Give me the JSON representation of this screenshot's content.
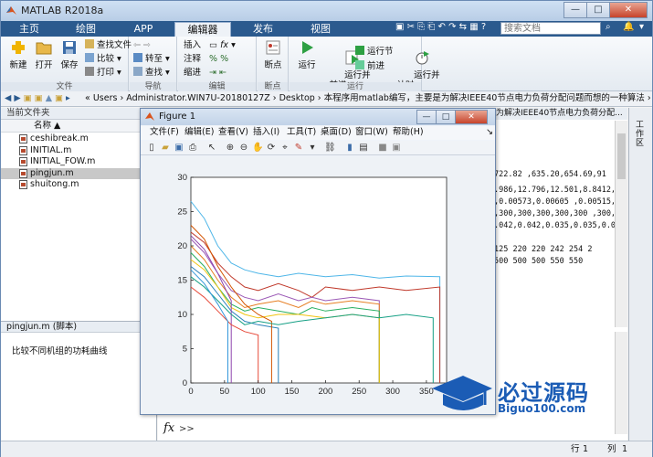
{
  "window": {
    "title": "MATLAB R2018a"
  },
  "tabs": [
    {
      "label": "主页"
    },
    {
      "label": "绘图"
    },
    {
      "label": "APP"
    },
    {
      "label": "编辑器"
    },
    {
      "label": "发布"
    },
    {
      "label": "视图"
    }
  ],
  "search": {
    "placeholder": "搜索文档"
  },
  "ribbon": {
    "file_group": {
      "label": "文件",
      "new": "新建",
      "open": "打开",
      "save": "保存",
      "find_files": "查找文件",
      "compare": "比较",
      "print": "打印"
    },
    "nav_group": {
      "label": "导航",
      "goto": "转至",
      "find": "查找"
    },
    "edit_group": {
      "label": "编辑",
      "insert": "插入",
      "comment": "注释",
      "indent": "缩进"
    },
    "breakpoint_group": {
      "label": "断点",
      "breakpoints": "断点"
    },
    "run_group": {
      "label": "运行",
      "run": "运行",
      "run_advance": "运行并\n前进",
      "run_section": "运行节",
      "advance": "前进",
      "run_time": "运行并\n计时"
    }
  },
  "address": {
    "path": "« Users › Administrator.WIN7U-20180127Z › Desktop › 本程序用matlab编写，主要是为解决IEEE40节点电力负荷分配问题而想的一种算法 › 水桶法"
  },
  "current_folder": {
    "title": "当前文件夹",
    "column": "名称",
    "files": [
      "ceshibreak.m",
      "INITIAL.m",
      "INITIAL_FOW.m",
      "pingjun.m",
      "shuitong.m"
    ],
    "selected_index": 3,
    "detail_title": "pingjun.m  (脚本)",
    "detail_text": "比较不同机组的功耗曲线"
  },
  "command_window": {
    "tab": "为解决IEEE40节点电力负荷分配...",
    "lines": [
      "722.82   ,635.20,654.69,91",
      ".986,12.796,12.501,8.8412,9.",
      ",0.00573,0.00605  ,0.00515,",
      ",300,300,300,300,300  ,300,",
      ".042,0.042,0.035,0.035,0.03",
      "",
      "125  220  220  242   254  2",
      "    500  500  500  550   550"
    ],
    "prompt": "fx",
    "prompt_arrows": ">>"
  },
  "right_panel": {
    "label": "工作区"
  },
  "statusbar": {
    "row_label": "行",
    "row": "1",
    "col_label": "列",
    "col": "1"
  },
  "figure": {
    "title": "Figure 1",
    "menus": [
      "文件(F)",
      "编辑(E)",
      "查看(V)",
      "插入(I)",
      "工具(T)",
      "桌面(D)",
      "窗口(W)",
      "帮助(H)"
    ]
  },
  "chart_data": {
    "type": "line",
    "xlim": [
      0,
      380
    ],
    "ylim": [
      0,
      30
    ],
    "xticks": [
      0,
      50,
      100,
      150,
      200,
      250,
      300,
      350
    ],
    "yticks": [
      0,
      5,
      10,
      15,
      20,
      25,
      30
    ],
    "grid": false,
    "series": [
      {
        "color": "#4fb6e8",
        "x": [
          0,
          20,
          40,
          60,
          80,
          100,
          130,
          160,
          200,
          240,
          280,
          320,
          370
        ],
        "y": [
          26.5,
          24,
          20,
          17.5,
          16.5,
          16,
          15.5,
          16,
          15.5,
          15.8,
          15.3,
          15.6,
          15.5
        ]
      },
      {
        "color": "#c0392b",
        "x": [
          0,
          20,
          40,
          60,
          80,
          100,
          130,
          160,
          180,
          200,
          240,
          280,
          320,
          370
        ],
        "y": [
          22,
          20.5,
          17.5,
          15.5,
          14,
          13.5,
          14.5,
          13.5,
          12.5,
          14,
          13.5,
          14,
          13.5,
          14
        ]
      },
      {
        "color": "#9b59b6",
        "x": [
          0,
          20,
          40,
          60,
          80,
          100,
          130,
          160,
          180,
          200,
          240,
          280
        ],
        "y": [
          21,
          19,
          16,
          13.5,
          12.5,
          12,
          13,
          12,
          12.5,
          12,
          12.5,
          12
        ]
      },
      {
        "color": "#e67e22",
        "x": [
          0,
          20,
          40,
          60,
          80,
          100,
          130,
          160,
          180,
          200,
          240,
          280
        ],
        "y": [
          20,
          18,
          15,
          12.5,
          11,
          11.5,
          12,
          11,
          12,
          11.5,
          12,
          11.5
        ]
      },
      {
        "color": "#27ae60",
        "x": [
          0,
          20,
          40,
          60,
          80,
          100,
          130,
          160,
          180,
          200,
          240,
          280
        ],
        "y": [
          19,
          17,
          14,
          11.5,
          10.5,
          11,
          10.5,
          10,
          11,
          10.5,
          11,
          10.5
        ]
      },
      {
        "color": "#f1c40f",
        "x": [
          0,
          20,
          40,
          60,
          80,
          100,
          130,
          160,
          200,
          240,
          280
        ],
        "y": [
          18,
          16.5,
          14,
          11,
          10,
          9.5,
          10,
          10,
          9.5,
          10,
          9.5
        ]
      },
      {
        "color": "#2980b9",
        "x": [
          0,
          20,
          40,
          60,
          80,
          100,
          130
        ],
        "y": [
          17,
          15.5,
          13,
          10.5,
          9,
          8.5,
          8
        ]
      },
      {
        "color": "#d35400",
        "x": [
          0,
          20,
          40,
          60,
          80,
          100,
          120
        ],
        "y": [
          23,
          21,
          17,
          14,
          11.5,
          10,
          9
        ]
      },
      {
        "color": "#8e44ad",
        "x": [
          0,
          20,
          40,
          50,
          60
        ],
        "y": [
          21.5,
          19.5,
          16,
          14,
          12
        ]
      },
      {
        "color": "#16a085",
        "x": [
          0,
          20,
          40,
          60,
          80,
          100,
          130,
          160,
          200,
          240,
          280,
          320,
          360
        ],
        "y": [
          15.5,
          14,
          12,
          10,
          8.5,
          9,
          8.5,
          9,
          9.5,
          10,
          9.5,
          10,
          9.5
        ]
      },
      {
        "color": "#e74c3c",
        "x": [
          0,
          20,
          40,
          60,
          80,
          100
        ],
        "y": [
          14,
          12.5,
          10.5,
          8.5,
          7.5,
          7
        ]
      },
      {
        "color": "#3498db",
        "x": [
          0,
          20,
          40,
          55
        ],
        "y": [
          16.5,
          14.5,
          11.5,
          9
        ]
      }
    ]
  }
}
